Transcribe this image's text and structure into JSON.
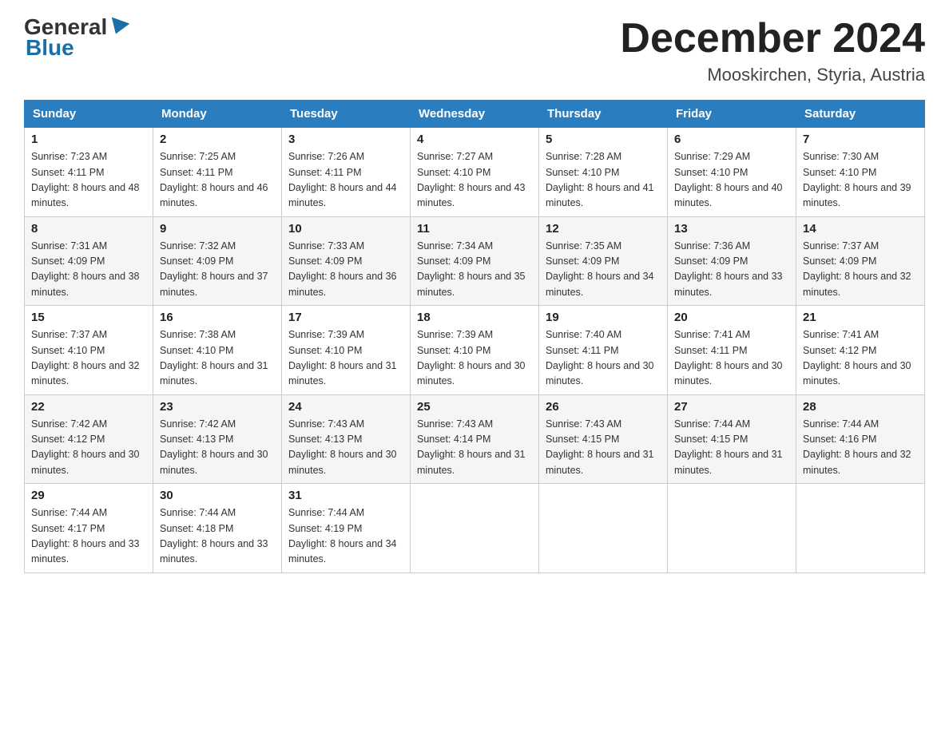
{
  "logo": {
    "general": "General",
    "blue": "Blue"
  },
  "title": "December 2024",
  "location": "Mooskirchen, Styria, Austria",
  "headers": [
    "Sunday",
    "Monday",
    "Tuesday",
    "Wednesday",
    "Thursday",
    "Friday",
    "Saturday"
  ],
  "weeks": [
    [
      {
        "day": "1",
        "sunrise": "7:23 AM",
        "sunset": "4:11 PM",
        "daylight": "8 hours and 48 minutes."
      },
      {
        "day": "2",
        "sunrise": "7:25 AM",
        "sunset": "4:11 PM",
        "daylight": "8 hours and 46 minutes."
      },
      {
        "day": "3",
        "sunrise": "7:26 AM",
        "sunset": "4:11 PM",
        "daylight": "8 hours and 44 minutes."
      },
      {
        "day": "4",
        "sunrise": "7:27 AM",
        "sunset": "4:10 PM",
        "daylight": "8 hours and 43 minutes."
      },
      {
        "day": "5",
        "sunrise": "7:28 AM",
        "sunset": "4:10 PM",
        "daylight": "8 hours and 41 minutes."
      },
      {
        "day": "6",
        "sunrise": "7:29 AM",
        "sunset": "4:10 PM",
        "daylight": "8 hours and 40 minutes."
      },
      {
        "day": "7",
        "sunrise": "7:30 AM",
        "sunset": "4:10 PM",
        "daylight": "8 hours and 39 minutes."
      }
    ],
    [
      {
        "day": "8",
        "sunrise": "7:31 AM",
        "sunset": "4:09 PM",
        "daylight": "8 hours and 38 minutes."
      },
      {
        "day": "9",
        "sunrise": "7:32 AM",
        "sunset": "4:09 PM",
        "daylight": "8 hours and 37 minutes."
      },
      {
        "day": "10",
        "sunrise": "7:33 AM",
        "sunset": "4:09 PM",
        "daylight": "8 hours and 36 minutes."
      },
      {
        "day": "11",
        "sunrise": "7:34 AM",
        "sunset": "4:09 PM",
        "daylight": "8 hours and 35 minutes."
      },
      {
        "day": "12",
        "sunrise": "7:35 AM",
        "sunset": "4:09 PM",
        "daylight": "8 hours and 34 minutes."
      },
      {
        "day": "13",
        "sunrise": "7:36 AM",
        "sunset": "4:09 PM",
        "daylight": "8 hours and 33 minutes."
      },
      {
        "day": "14",
        "sunrise": "7:37 AM",
        "sunset": "4:09 PM",
        "daylight": "8 hours and 32 minutes."
      }
    ],
    [
      {
        "day": "15",
        "sunrise": "7:37 AM",
        "sunset": "4:10 PM",
        "daylight": "8 hours and 32 minutes."
      },
      {
        "day": "16",
        "sunrise": "7:38 AM",
        "sunset": "4:10 PM",
        "daylight": "8 hours and 31 minutes."
      },
      {
        "day": "17",
        "sunrise": "7:39 AM",
        "sunset": "4:10 PM",
        "daylight": "8 hours and 31 minutes."
      },
      {
        "day": "18",
        "sunrise": "7:39 AM",
        "sunset": "4:10 PM",
        "daylight": "8 hours and 30 minutes."
      },
      {
        "day": "19",
        "sunrise": "7:40 AM",
        "sunset": "4:11 PM",
        "daylight": "8 hours and 30 minutes."
      },
      {
        "day": "20",
        "sunrise": "7:41 AM",
        "sunset": "4:11 PM",
        "daylight": "8 hours and 30 minutes."
      },
      {
        "day": "21",
        "sunrise": "7:41 AM",
        "sunset": "4:12 PM",
        "daylight": "8 hours and 30 minutes."
      }
    ],
    [
      {
        "day": "22",
        "sunrise": "7:42 AM",
        "sunset": "4:12 PM",
        "daylight": "8 hours and 30 minutes."
      },
      {
        "day": "23",
        "sunrise": "7:42 AM",
        "sunset": "4:13 PM",
        "daylight": "8 hours and 30 minutes."
      },
      {
        "day": "24",
        "sunrise": "7:43 AM",
        "sunset": "4:13 PM",
        "daylight": "8 hours and 30 minutes."
      },
      {
        "day": "25",
        "sunrise": "7:43 AM",
        "sunset": "4:14 PM",
        "daylight": "8 hours and 31 minutes."
      },
      {
        "day": "26",
        "sunrise": "7:43 AM",
        "sunset": "4:15 PM",
        "daylight": "8 hours and 31 minutes."
      },
      {
        "day": "27",
        "sunrise": "7:44 AM",
        "sunset": "4:15 PM",
        "daylight": "8 hours and 31 minutes."
      },
      {
        "day": "28",
        "sunrise": "7:44 AM",
        "sunset": "4:16 PM",
        "daylight": "8 hours and 32 minutes."
      }
    ],
    [
      {
        "day": "29",
        "sunrise": "7:44 AM",
        "sunset": "4:17 PM",
        "daylight": "8 hours and 33 minutes."
      },
      {
        "day": "30",
        "sunrise": "7:44 AM",
        "sunset": "4:18 PM",
        "daylight": "8 hours and 33 minutes."
      },
      {
        "day": "31",
        "sunrise": "7:44 AM",
        "sunset": "4:19 PM",
        "daylight": "8 hours and 34 minutes."
      },
      null,
      null,
      null,
      null
    ]
  ]
}
